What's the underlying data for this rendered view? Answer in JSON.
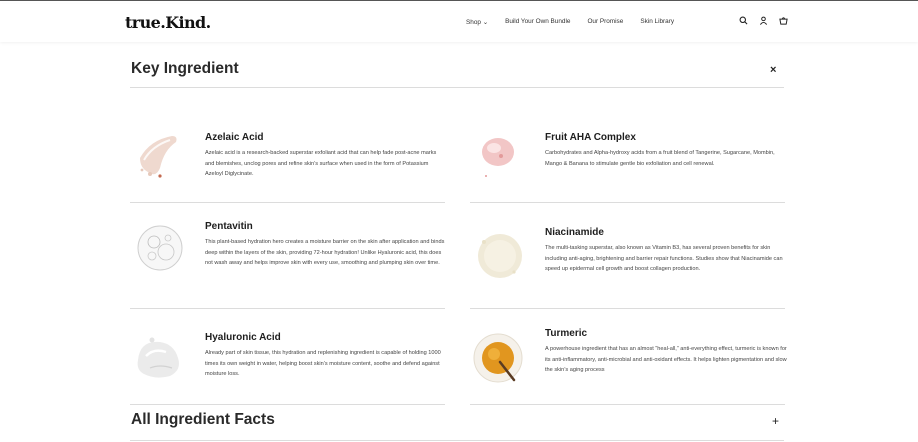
{
  "header": {
    "logo": "true.Kind.",
    "nav": [
      "Shop ⌄",
      "Build Your Own Bundle",
      "Our Promise",
      "Skin Library"
    ]
  },
  "key_section": {
    "title": "Key Ingredient",
    "close": "×"
  },
  "ingredients": [
    {
      "name": "Azelaic Acid",
      "desc": "Azelaic acid is a research-backed superstar exfoliant acid that can help fade post-acne marks and blemishes, unclog pores and refine skin’s surface when used in the form of Potassium Azeloyl Diglycinate."
    },
    {
      "name": "Fruit AHA Complex",
      "desc": "Carbohydrates and Alpha-hydroxy acids from a fruit blend of Tangerine, Sugarcane, Mombin, Mango & Banana to stimulate gentle bio exfoliation and cell renewal."
    },
    {
      "name": "Pentavitin",
      "desc": "This plant-based hydration hero creates a moisture barrier on the skin after application and binds deep within the layers of the skin, providing 72-hour hydration! Unlike Hyaluronic acid, this does not wash away and helps improve skin with every use, smoothing and plumping skin over time."
    },
    {
      "name": "Niacinamide",
      "desc": "The multi-tasking superstar, also known as Vitamin B3, has several proven benefits for skin including anti-aging, brightening and barrier repair functions. Studies show that Niacinamide can speed up epidermal cell growth and boost collagen production."
    },
    {
      "name": "Hyaluronic Acid",
      "desc": "Already part of skin tissue, this hydration and replenishing ingredient is capable of holding 1000 times its own weight in water, helping boost skin’s moisture content, soothe and defend against moisture loss."
    },
    {
      "name": "Turmeric",
      "desc": "A powerhouse ingredient that has an almost “heal-all,” anti-everything effect, turmeric is known for its anti-inflammatory, anti-microbial and anti-oxidant effects. It helps lighten pigmentation and slow the skin’s aging process"
    }
  ],
  "facts_section": {
    "title": "All Ingredient Facts",
    "toggle": "+"
  }
}
